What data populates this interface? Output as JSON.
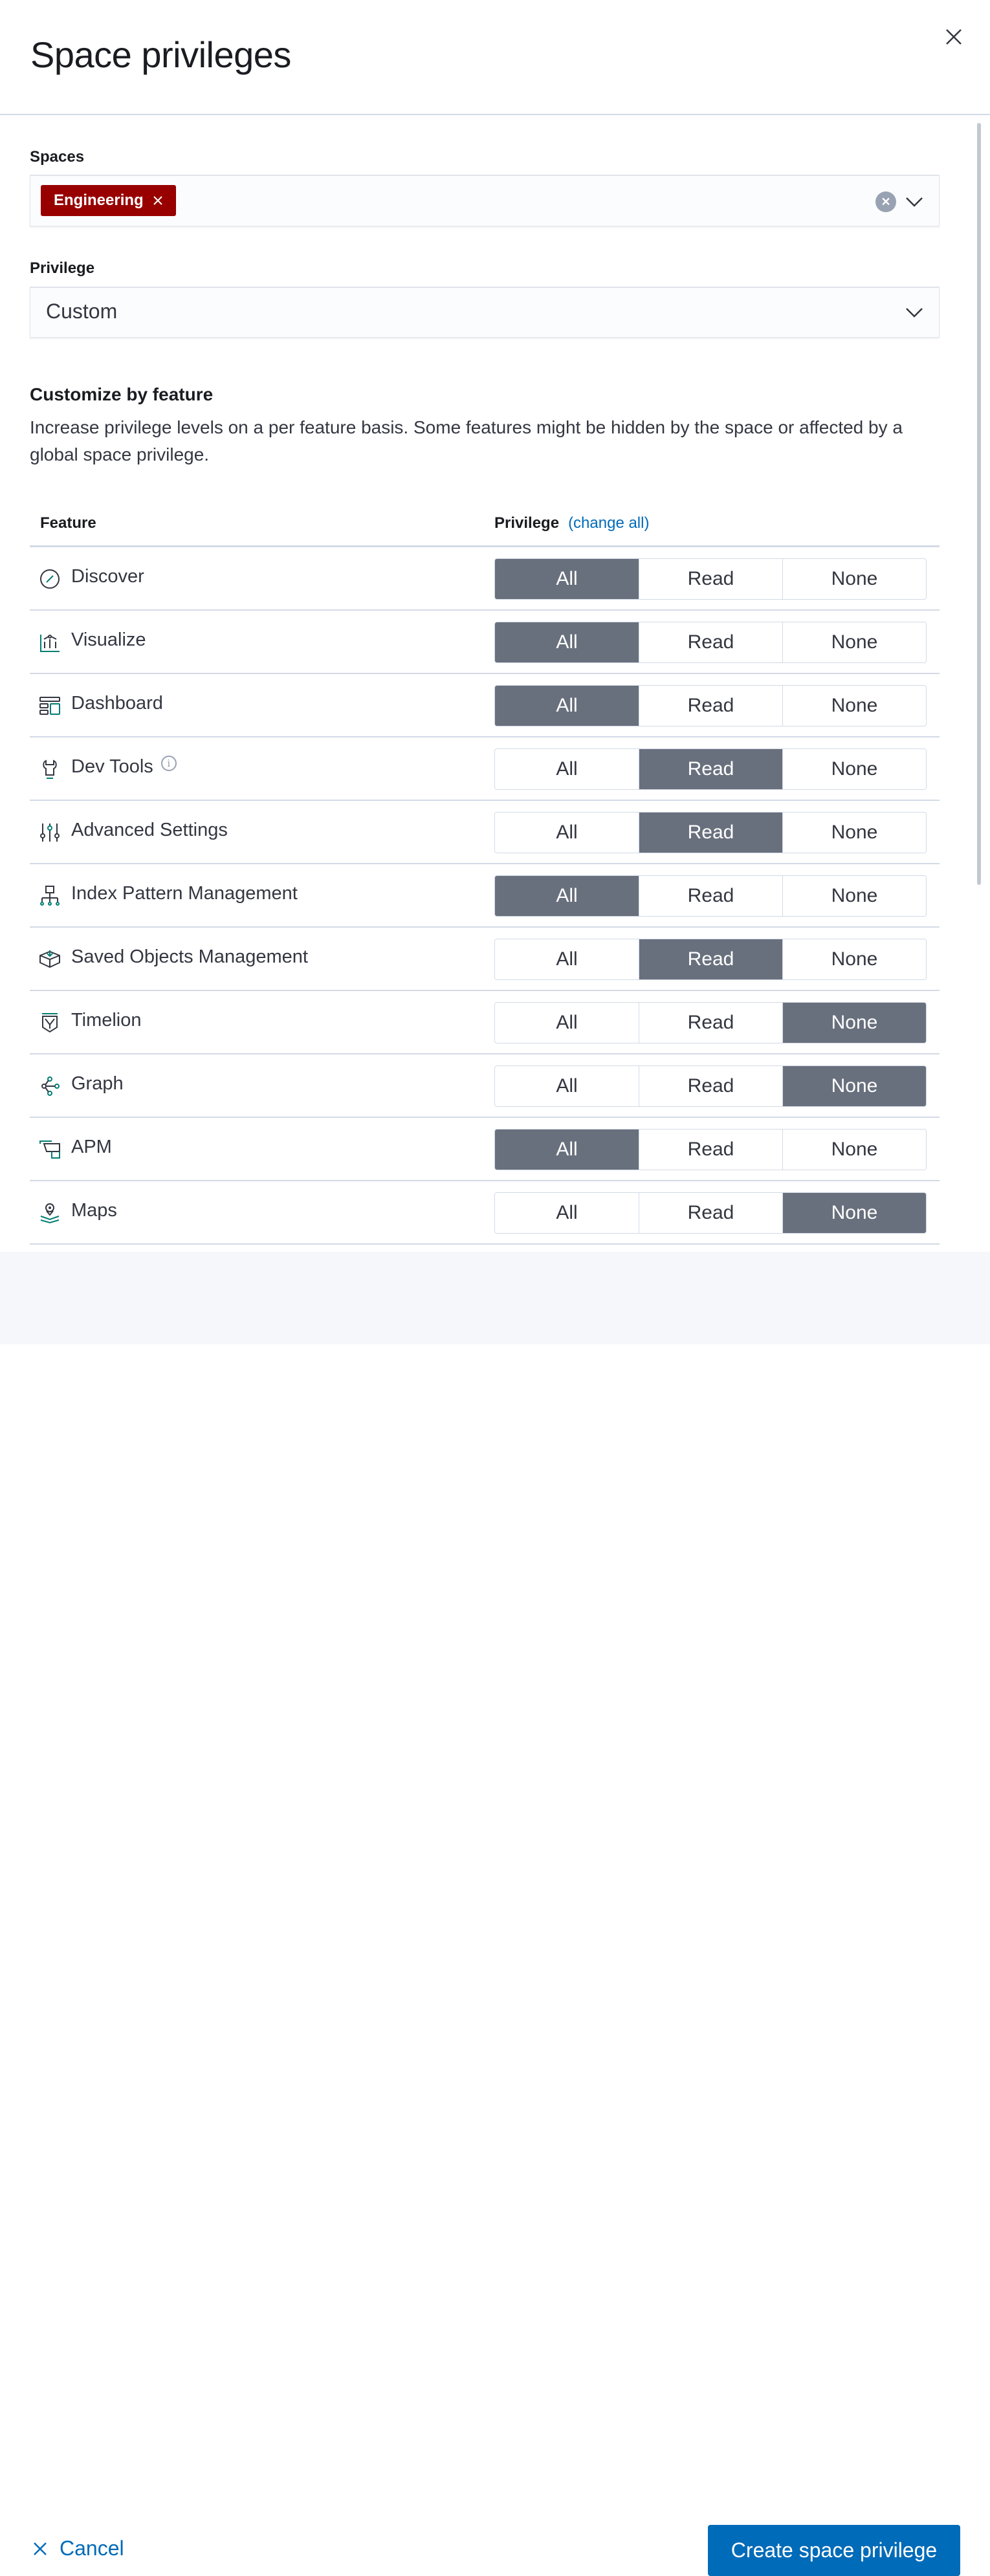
{
  "flyout": {
    "title": "Space privileges"
  },
  "spaces": {
    "label": "Spaces",
    "selected": [
      {
        "name": "Engineering",
        "color": "#980000"
      }
    ]
  },
  "privilege": {
    "label": "Privilege",
    "value": "Custom"
  },
  "customize": {
    "heading": "Customize by feature",
    "description": "Increase privilege levels on a per feature basis. Some features might be hidden by the space or affected by a global space privilege."
  },
  "table": {
    "col_feature": "Feature",
    "col_privilege": "Privilege",
    "change_all": "(change all)",
    "options": [
      "All",
      "Read",
      "None"
    ],
    "rows": [
      {
        "icon": "compass-icon",
        "name": "Discover",
        "selected": "All"
      },
      {
        "icon": "visualize-icon",
        "name": "Visualize",
        "selected": "All"
      },
      {
        "icon": "dashboard-icon",
        "name": "Dashboard",
        "selected": "All"
      },
      {
        "icon": "wrench-icon",
        "name": "Dev Tools",
        "selected": "Read",
        "info": "i"
      },
      {
        "icon": "sliders-icon",
        "name": "Advanced Settings",
        "selected": "Read"
      },
      {
        "icon": "index-pattern-icon",
        "name": "Index Pattern Management",
        "selected": "All"
      },
      {
        "icon": "box-icon",
        "name": "Saved Objects Management",
        "selected": "Read"
      },
      {
        "icon": "timelion-icon",
        "name": "Timelion",
        "selected": "None"
      },
      {
        "icon": "graph-icon",
        "name": "Graph",
        "selected": "None"
      },
      {
        "icon": "apm-icon",
        "name": "APM",
        "selected": "All"
      },
      {
        "icon": "maps-icon",
        "name": "Maps",
        "selected": "None"
      }
    ]
  },
  "footer": {
    "cancel": "Cancel",
    "create": "Create space privilege"
  },
  "colors": {
    "primary": "#006bb8",
    "selected_button": "#69707d",
    "icon_teal": "#017d73"
  }
}
